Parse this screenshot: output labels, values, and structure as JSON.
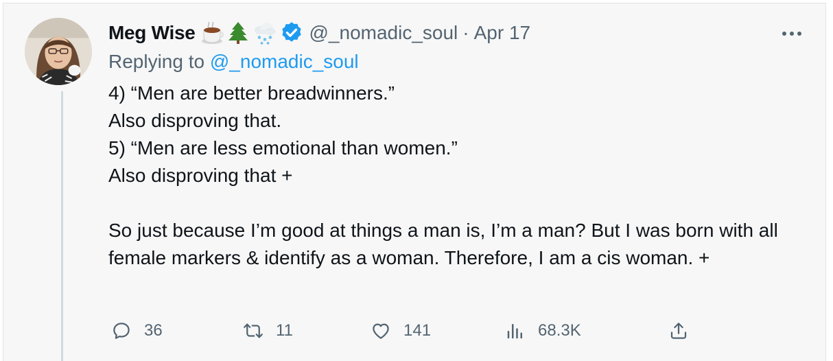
{
  "tweet": {
    "author": {
      "name": "Meg Wise",
      "emojis": [
        "coffee-emoji",
        "evergreen-tree-emoji",
        "snow-cloud-emoji"
      ],
      "verified": true,
      "handle": "@_nomadic_soul",
      "separator": "·",
      "date": "Apr 17"
    },
    "reply": {
      "prefix": "Replying to",
      "mention": "@_nomadic_soul"
    },
    "text_lines": [
      "4) “Men are better breadwinners.”",
      "Also disproving that.",
      "5) “Men are less emotional than women.”",
      "Also disproving that +"
    ],
    "paragraph2": "So just because I’m good at things a man is, I’m a man? But I was born with all female markers & identify as a woman. Therefore, I am a cis woman. +",
    "actions": {
      "replies": "36",
      "retweets": "11",
      "likes": "141",
      "views": "68.3K"
    }
  },
  "colors": {
    "card_bg": "#f7f7f7",
    "text": "#0f1419",
    "secondary": "#536471",
    "link": "#1d9bf0",
    "thread_line": "#cfd9de"
  }
}
